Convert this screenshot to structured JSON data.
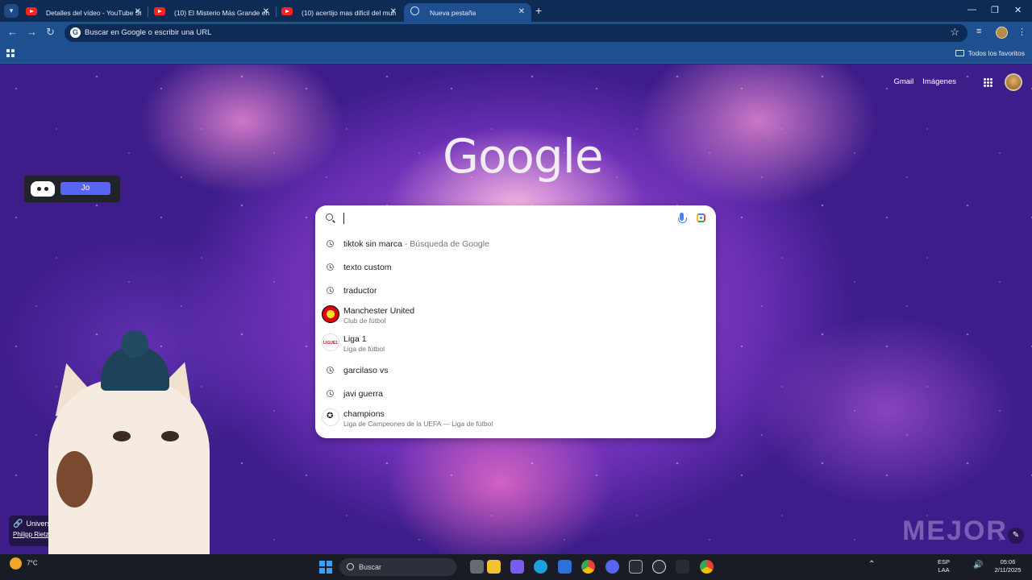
{
  "tabs": [
    {
      "title": "Detalles del vídeo - YouTube St"
    },
    {
      "title": "(10) El Misterio Más Grande en"
    },
    {
      "title": "(10) acertijo mas dificil del mun"
    },
    {
      "title": "Nueva pestaña"
    }
  ],
  "omnibox": {
    "placeholder": "Buscar en Google o escribir una URL"
  },
  "bookmarks": {
    "all_label": "Todos los favoritos"
  },
  "header_links": {
    "gmail": "Gmail",
    "images": "Imágenes"
  },
  "logo": "Google",
  "discord": {
    "join_label": "Jo"
  },
  "suggestions": [
    {
      "text": "tiktok sin marca",
      "suffix": " - Búsqueda de Google",
      "kind": "history"
    },
    {
      "text": "texto custom",
      "kind": "history"
    },
    {
      "text": "traductor",
      "kind": "history"
    },
    {
      "text": "Manchester United",
      "sub": "Club de fútbol",
      "kind": "entity"
    },
    {
      "text": "Liga 1",
      "sub": "Liga de fútbol",
      "kind": "entity"
    },
    {
      "text": "garcilaso vs",
      "kind": "history"
    },
    {
      "text": "javi guerra",
      "kind": "history"
    },
    {
      "text": "champions",
      "sub": "Liga de Campeones de la UEFA — Liga de fútbol",
      "kind": "entity"
    }
  ],
  "attribution": {
    "title": "Universe",
    "author": "Philipp Rietz"
  },
  "watermark": "MEJOR",
  "taskbar": {
    "weather_temp": "7°C",
    "search_label": "Buscar",
    "lang_top": "ESP",
    "lang_bottom": "LAA",
    "time": "05:06",
    "date": "2/11/2025"
  }
}
